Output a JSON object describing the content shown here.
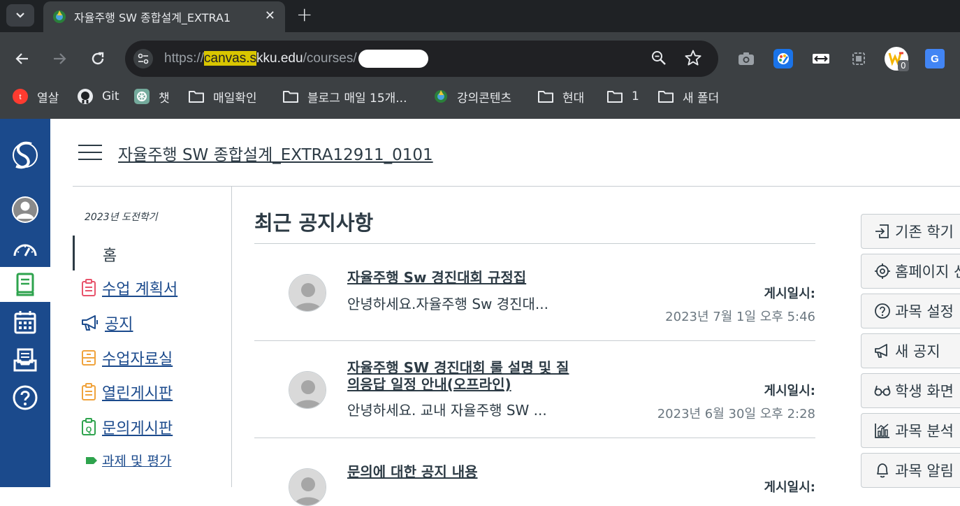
{
  "browser": {
    "tab_title": "자율주행 SW 종합설계_EXTRA1",
    "url_prefix": "https://",
    "url_host_highlight": "canvas.s",
    "url_host_rest": "kku.edu",
    "url_path": "/courses/",
    "extension_badge": "0"
  },
  "bookmarks": [
    {
      "label": "열살",
      "icon": "tving-icon"
    },
    {
      "label": "Git",
      "icon": "github-icon"
    },
    {
      "label": "챗",
      "icon": "chatgpt-icon"
    },
    {
      "label": "매일확인",
      "icon": "folder-icon"
    },
    {
      "label": "블로그 매일 15개...",
      "icon": "folder-icon"
    },
    {
      "label": "강의콘텐츠",
      "icon": "canvas-icon"
    },
    {
      "label": "현대",
      "icon": "folder-icon"
    },
    {
      "label": "1",
      "icon": "folder-icon"
    },
    {
      "label": "새 폴더",
      "icon": "folder-icon"
    }
  ],
  "course": {
    "title": "자율주행 SW 종합설계_EXTRA12911_0101"
  },
  "course_menu": {
    "term": "2023년 도전학기",
    "home": "홈",
    "items": [
      {
        "label": "수업 계획서",
        "color": "#e8546c"
      },
      {
        "label": "공지",
        "color": "#1b4a8c"
      },
      {
        "label": "수업자료실",
        "color": "#f0a33c"
      },
      {
        "label": "열린게시판",
        "color": "#f0a33c"
      },
      {
        "label": "문의게시판",
        "color": "#2ea34d"
      },
      {
        "label": "과제 및 평가",
        "color": "#2ea34d"
      }
    ]
  },
  "announcements": {
    "heading": "최근 공지사항",
    "posted_label": "게시일시:",
    "items": [
      {
        "title": "자율주행 Sw 경진대회 규정집",
        "summary": "안녕하세요.자율주행 Sw 경진대...",
        "date": "2023년 7월 1일 오후 5:46"
      },
      {
        "title": "자율주행 SW 경진대회 룰 설명 및 질의응답 일정 안내(오프라인)",
        "summary": "안녕하세요. 교내 자율주행 SW ...",
        "date": "2023년 6월 30일 오후 2:28"
      },
      {
        "title": "문의에 대한 공지 내용",
        "summary": "",
        "date": ""
      }
    ]
  },
  "sidebar_buttons": [
    {
      "label": "기존 학기",
      "icon": "import-icon"
    },
    {
      "label": "홈페이지 선",
      "icon": "target-icon"
    },
    {
      "label": "과목 설정",
      "icon": "question-icon"
    },
    {
      "label": "새 공지",
      "icon": "megaphone-icon"
    },
    {
      "label": "학생 화면",
      "icon": "glasses-icon"
    },
    {
      "label": "과목 분석",
      "icon": "analytics-icon"
    },
    {
      "label": "과목 알림",
      "icon": "bell-icon"
    }
  ]
}
